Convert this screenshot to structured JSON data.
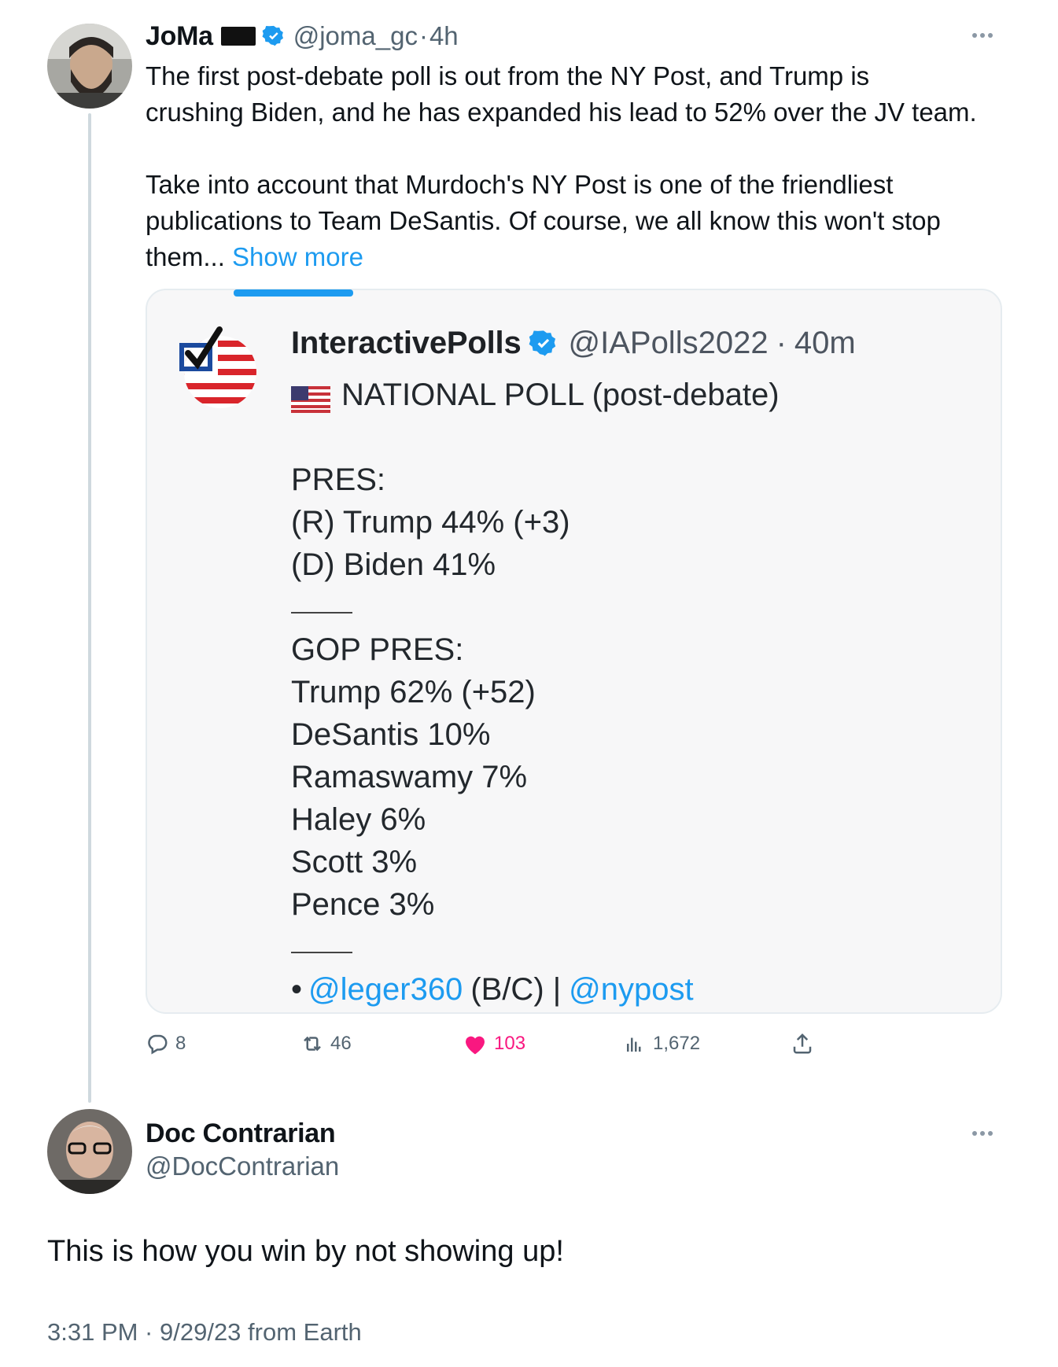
{
  "tweet": {
    "author": "JoMa",
    "handle": "@joma_gc",
    "separator": "·",
    "time": "4h",
    "text_main": "The first post-debate poll is out from the NY Post, and Trump is\ncrushing Biden, and he has expanded his lead to 52% over the JV team.\n\nTake into account that Murdoch's NY Post is one of the friendliest\npublications to Team DeSantis. Of course, we all know this won't stop\nthem...",
    "show_more": "Show more"
  },
  "quote": {
    "author": "InteractivePolls",
    "handle": "@IAPolls2022",
    "separator": "·",
    "time": "40m",
    "line_title": "NATIONAL POLL (post-debate)",
    "pres_header": "PRES:",
    "pres_1": "(R) Trump 44% (+3)",
    "pres_2": "(D) Biden 41%",
    "gop_header": "GOP PRES:",
    "gop_1": "Trump 62% (+52)",
    "gop_2": "DeSantis 10%",
    "gop_3": "Ramaswamy 7%",
    "gop_4": "Haley 6%",
    "gop_5": "Scott 3%",
    "gop_6": "Pence 3%",
    "source_bullet": "•",
    "source_link1": "@leger360",
    "source_mid": "(B/C) |",
    "source_link2": "@nypost"
  },
  "actions": {
    "replies": "8",
    "retweets": "46",
    "likes": "103",
    "views": "1,672"
  },
  "reply": {
    "author": "Doc Contrarian",
    "handle": "@DocContrarian",
    "text": "This is how you win by not showing up!",
    "timestamp": "3:31 PM · 9/29/23 from Earth"
  },
  "colors": {
    "accent": "#1d9bf0",
    "like": "#f91880",
    "muted": "#536471"
  }
}
